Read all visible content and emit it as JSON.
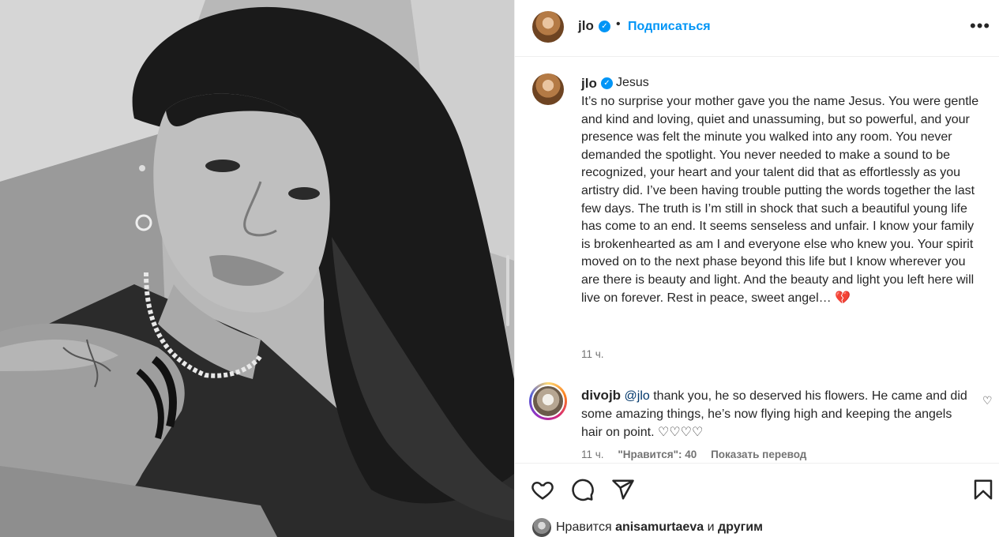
{
  "post": {
    "author": "jlo",
    "follow_label": "Подписаться",
    "more_label": "•••"
  },
  "caption": {
    "author": "jlo",
    "heading": "Jesus",
    "text": "It’s no surprise your mother gave you the name Jesus. You were gentle and kind and loving, quiet and unassuming, but so powerful, and your presence was felt the minute you walked into any room. You never demanded the spotlight. You never needed to make a sound to be recognized, your heart and your talent did that as effortlessly as you artistry did. I’ve been having trouble putting the words together the last few days. The truth is I’m still in shock that such a beautiful young life has come to an end. It seems senseless and unfair. I know your family is brokenhearted as am I and everyone else who knew you. Your spirit moved on to the next phase beyond this life but I know wherever you are there is beauty and light. And the beauty and light you left here will live on forever. Rest in peace, sweet angel…",
    "emoji": "💔",
    "time": "11 ч."
  },
  "comment": {
    "author": "divojb",
    "mention": "@jlo",
    "text": "thank you, he so deserved his flowers. He came and did some amazing things, he’s now flying high and keeping the angels hair on point.",
    "hearts": "♡♡♡♡",
    "time": "11 ч.",
    "likes": "\"Нравится\": 40",
    "translate": "Показать перевод",
    "like_icon": "♡"
  },
  "likes": {
    "prefix": "Нравится",
    "user": "anisamurtaeva",
    "conj": "и",
    "others": "другим"
  },
  "colors": {
    "accent": "#0095f6",
    "verified": "#0095f6",
    "mention": "#00376b",
    "muted": "#737373"
  },
  "icons": [
    "verified-badge-icon",
    "more-options-icon",
    "heart-icon",
    "comment-icon",
    "share-icon",
    "bookmark-icon",
    "broken-heart-icon"
  ]
}
